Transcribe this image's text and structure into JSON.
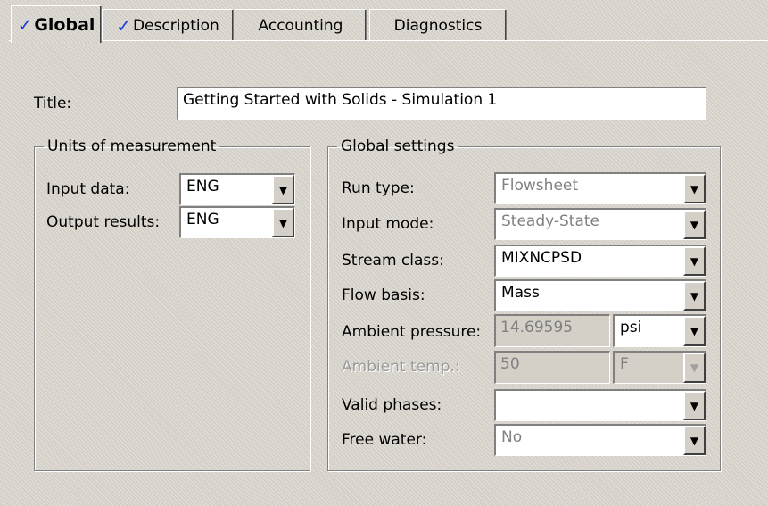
{
  "tabs": [
    {
      "label": "Global",
      "checked": true,
      "active": true
    },
    {
      "label": "Description",
      "checked": true,
      "active": false
    },
    {
      "label": "Accounting",
      "checked": false,
      "active": false
    },
    {
      "label": "Diagnostics",
      "checked": false,
      "active": false
    }
  ],
  "check_glyph": "✓",
  "title_field": {
    "label": "Title:",
    "value": "Getting Started with Solids - Simulation 1"
  },
  "units": {
    "legend": "Units of measurement",
    "input_label": "Input data:",
    "input_value": "ENG",
    "output_label": "Output results:",
    "output_value": "ENG"
  },
  "global_settings": {
    "legend": "Global settings",
    "run_type_label": "Run type:",
    "run_type_value": "Flowsheet",
    "input_mode_label": "Input mode:",
    "input_mode_value": "Steady-State",
    "stream_class_label": "Stream class:",
    "stream_class_value": "MIXNCPSD",
    "flow_basis_label": "Flow basis:",
    "flow_basis_value": "Mass",
    "ambient_pressure_label": "Ambient pressure:",
    "ambient_pressure_value": "14.69595",
    "ambient_pressure_unit": "psi",
    "ambient_temp_label": "Ambient temp.:",
    "ambient_temp_value": "50",
    "ambient_temp_unit": "F",
    "valid_phases_label": "Valid phases:",
    "valid_phases_value": "",
    "free_water_label": "Free water:",
    "free_water_value": "No"
  },
  "dropdown_arrow_glyph": "▼"
}
